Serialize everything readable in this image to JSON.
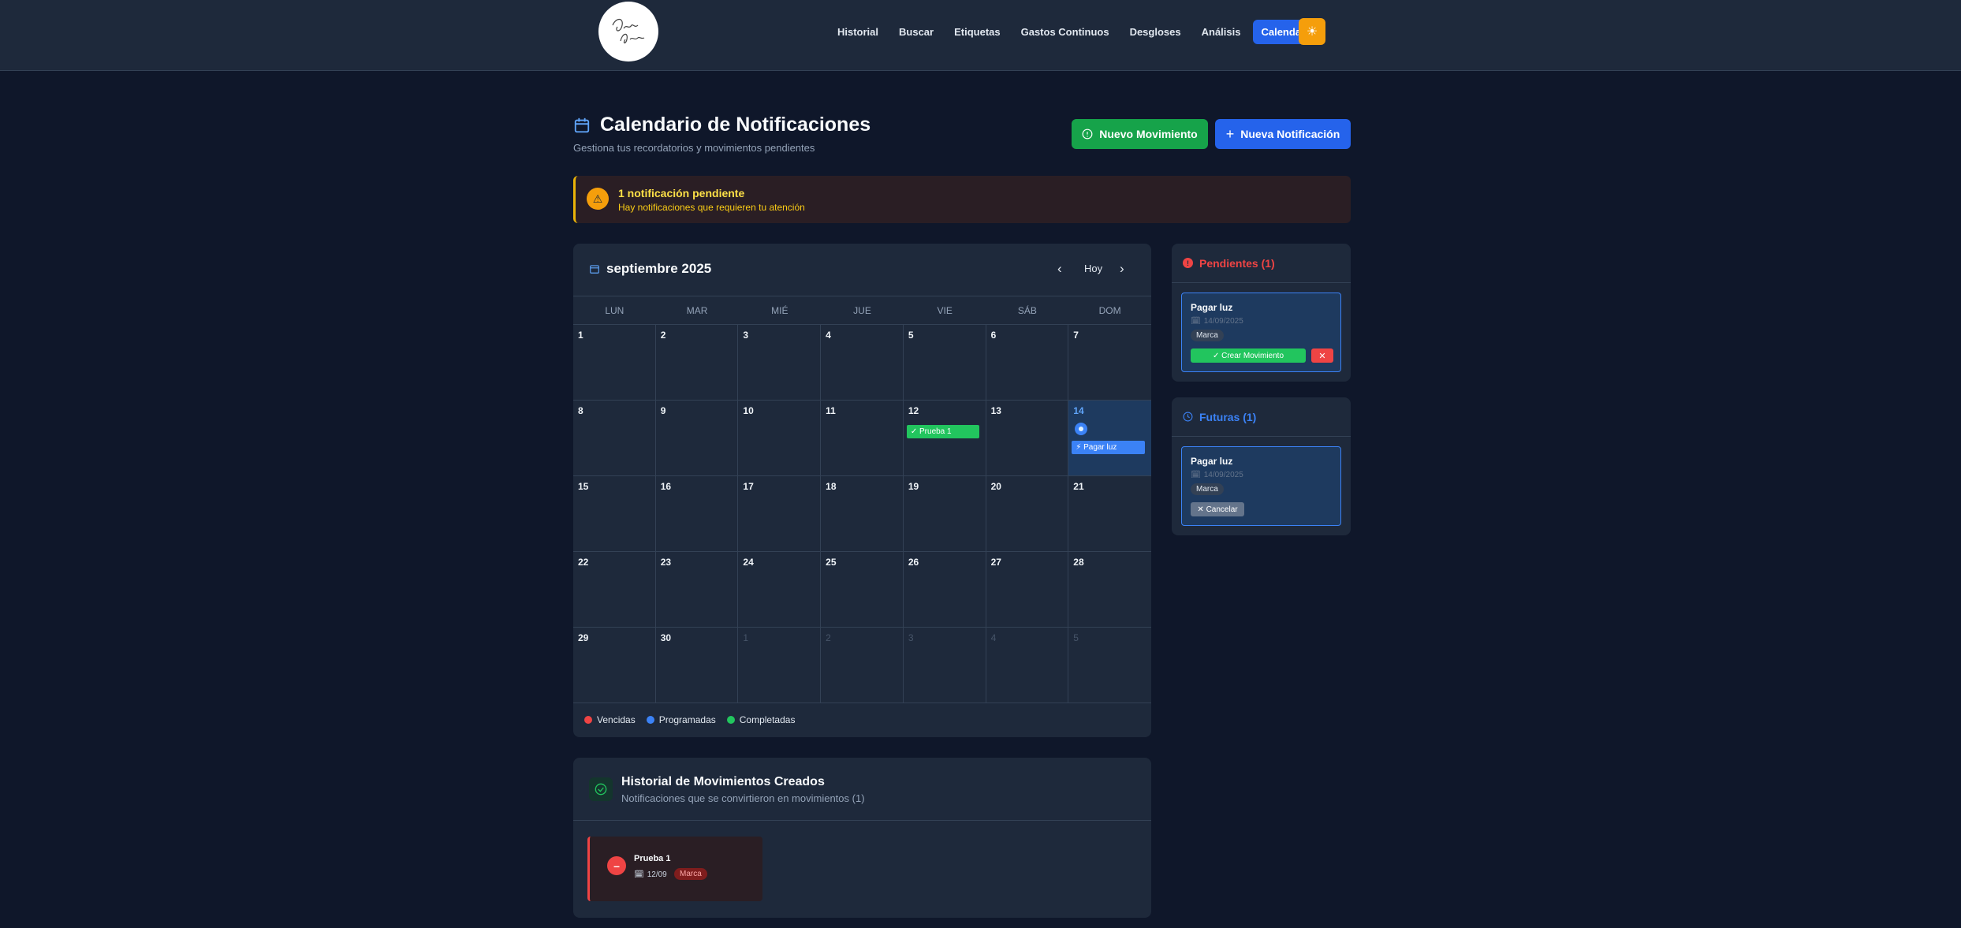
{
  "logo": {
    "text": "Diego Acuna"
  },
  "nav": {
    "items": [
      "Historial",
      "Buscar",
      "Etiquetas",
      "Gastos Continuos",
      "Desgloses",
      "Análisis",
      "Calendario"
    ],
    "active": "Calendario",
    "theme_icon": "sun-icon"
  },
  "header": {
    "title": "Calendario de Notificaciones",
    "subtitle": "Gestiona tus recordatorios y movimientos pendientes",
    "btn_movimiento": "Nuevo Movimiento",
    "btn_notificacion": "Nueva Notificación"
  },
  "alert": {
    "title": "1 notificación pendiente",
    "text": "Hay notificaciones que requieren tu atención"
  },
  "calendar": {
    "month": "septiembre 2025",
    "today_label": "Hoy",
    "weekdays": [
      "LUN",
      "MAR",
      "MIÉ",
      "JUE",
      "VIE",
      "SÁB",
      "DOM"
    ],
    "days": [
      {
        "n": "1"
      },
      {
        "n": "2"
      },
      {
        "n": "3"
      },
      {
        "n": "4"
      },
      {
        "n": "5"
      },
      {
        "n": "6"
      },
      {
        "n": "7"
      },
      {
        "n": "8"
      },
      {
        "n": "9"
      },
      {
        "n": "10"
      },
      {
        "n": "11"
      },
      {
        "n": "12",
        "event": "✓ Prueba 1",
        "event_type": "completed"
      },
      {
        "n": "13"
      },
      {
        "n": "14",
        "today": true,
        "event": "⚡ Pagar luz",
        "event_type": "scheduled"
      },
      {
        "n": "15"
      },
      {
        "n": "16"
      },
      {
        "n": "17"
      },
      {
        "n": "18"
      },
      {
        "n": "19"
      },
      {
        "n": "20"
      },
      {
        "n": "21"
      },
      {
        "n": "22"
      },
      {
        "n": "23"
      },
      {
        "n": "24"
      },
      {
        "n": "25"
      },
      {
        "n": "26"
      },
      {
        "n": "27"
      },
      {
        "n": "28"
      },
      {
        "n": "29"
      },
      {
        "n": "30"
      },
      {
        "n": "1",
        "other": true
      },
      {
        "n": "2",
        "other": true
      },
      {
        "n": "3",
        "other": true
      },
      {
        "n": "4",
        "other": true
      },
      {
        "n": "5",
        "other": true
      }
    ],
    "legend": [
      {
        "label": "Vencidas",
        "color": "#ef4444"
      },
      {
        "label": "Programadas",
        "color": "#3b82f6"
      },
      {
        "label": "Completadas",
        "color": "#22c55e"
      }
    ]
  },
  "pending": {
    "title": "Pendientes (1)",
    "card": {
      "title": "Pagar luz",
      "date": "14/09/2025",
      "tag": "Marca",
      "btn_create": "✓ Crear Movimiento",
      "btn_delete": "✕"
    }
  },
  "future": {
    "title": "Futuras (1)",
    "card": {
      "title": "Pagar luz",
      "date": "14/09/2025",
      "tag": "Marca",
      "btn_cancel": "✕ Cancelar"
    }
  },
  "history": {
    "title": "Historial de Movimientos Creados",
    "subtitle": "Notificaciones que se convirtieron en movimientos (1)",
    "card": {
      "title": "Prueba 1",
      "date": "12/09",
      "tag": "Marca"
    }
  },
  "colors": {
    "background": "#0f172a",
    "panel": "#1e293b",
    "accent_blue": "#2563eb",
    "accent_green": "#16a34a",
    "danger": "#ef4444",
    "warning": "#f59e0b"
  }
}
